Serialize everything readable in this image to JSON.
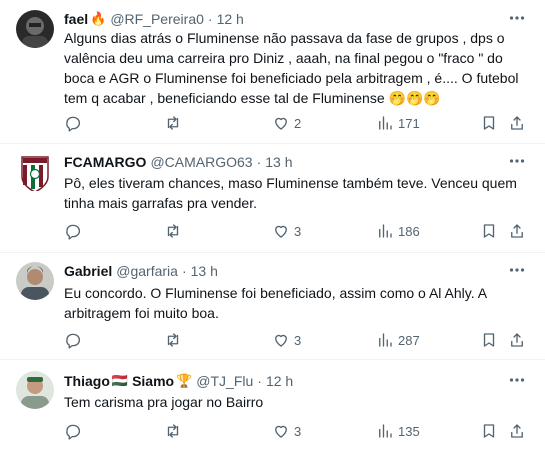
{
  "tweets": [
    {
      "name": "fael",
      "name_emoji": "🔥",
      "handle": "@RF_Pereira0",
      "sep": "·",
      "time": "12 h",
      "lines": [
        "Alguns dias atrás o Fluminense não passava da fase de grupos , dps o",
        "valência deu uma carreira pro Diniz , aaah, na final pegou o \"fraco \" do",
        "boca  e AGR o Fluminense foi beneficiado pela arbitragem , é.... O futebol",
        "tem q acabar , beneficiando esse tal de Fluminense  🤭🤭🤭"
      ],
      "replies": "",
      "retweets": "",
      "likes": "2",
      "views": "171"
    },
    {
      "name": "FCAMARGO",
      "name_emoji": "",
      "handle": "@CAMARGO63",
      "sep": "·",
      "time": "13 h",
      "lines": [
        "Pô, eles tiveram chances, maso Fluminense também teve. Venceu quem",
        "tinha mais garrafas pra vender."
      ],
      "replies": "",
      "retweets": "",
      "likes": "3",
      "views": "186"
    },
    {
      "name": "Gabriel",
      "name_emoji": "",
      "handle": "@garfaria",
      "sep": "·",
      "time": "13 h",
      "lines": [
        "Eu concordo. O Fluminense foi beneficiado, assim como o Al Ahly. A",
        "arbitragem foi muito boa."
      ],
      "replies": "",
      "retweets": "",
      "likes": "3",
      "views": "287"
    },
    {
      "name": "Thiago",
      "name_emoji": "🇭🇺",
      "name_suffix": "Siamo",
      "suffix_emoji": "🏆",
      "handle": "@TJ_Flu",
      "sep": "·",
      "time": "12 h",
      "lines": [
        "Tem carisma pra jogar no Bairro"
      ],
      "replies": "",
      "retweets": "",
      "likes": "3",
      "views": "135"
    }
  ],
  "colors": {
    "text_primary": "#0f1419",
    "text_secondary": "#536471",
    "divider": "#eff3f4"
  },
  "icons": {
    "more": "more-dots-icon",
    "reply": "reply-icon",
    "retweet": "retweet-icon",
    "like": "heart-icon",
    "views": "views-chart-icon",
    "bookmark": "bookmark-icon",
    "share": "share-icon"
  }
}
